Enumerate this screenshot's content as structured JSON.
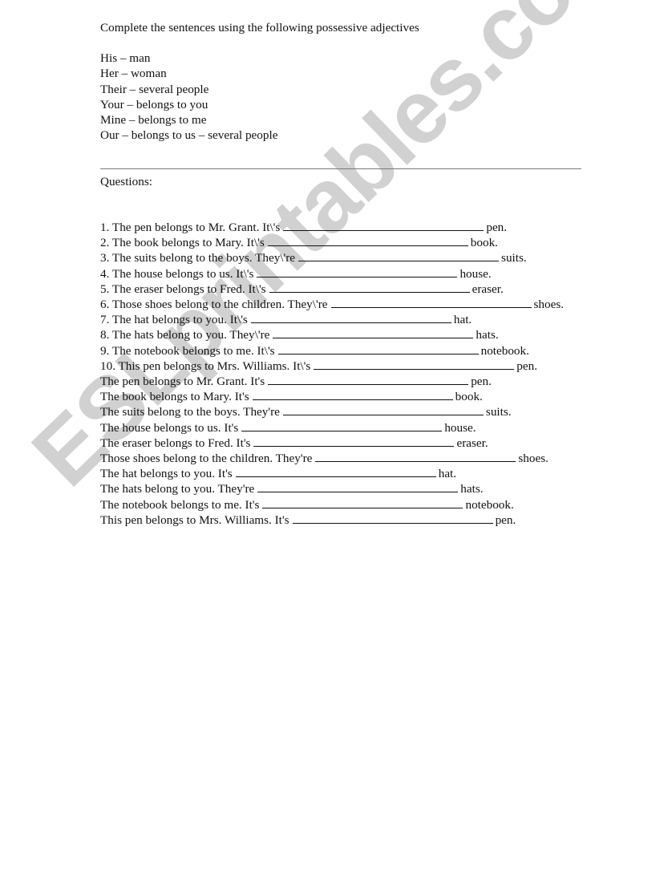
{
  "worksheet": {
    "title": "Complete the sentences using the following possessive adjectives",
    "legend": [
      "His – man",
      "Her – woman",
      "Their – several people",
      "Your – belongs to you",
      "Mine – belongs to me",
      "Our – belongs to us – several people"
    ],
    "questions_label": "Questions:",
    "questions": [
      {
        "before": "1. The pen belongs to Mr. Grant. It\\'s",
        "after": "pen."
      },
      {
        "before": "2. The book belongs to Mary. It\\'s",
        "after": "book."
      },
      {
        "before": "3. The suits belong to the boys. They\\'re",
        "after": "suits."
      },
      {
        "before": "4. The house belongs to us. It\\'s",
        "after": "house."
      },
      {
        "before": "5. The eraser belongs to Fred. It\\'s",
        "after": "eraser."
      },
      {
        "before": "6. Those shoes belong to the children. They\\'re",
        "after": "shoes."
      },
      {
        "before": "7. The hat belongs to you. It\\'s",
        "after": "hat."
      },
      {
        "before": "8. The hats belong to you. They\\'re",
        "after": "hats."
      },
      {
        "before": "9. The notebook belongs to me. It\\'s",
        "after": "notebook."
      },
      {
        "before": "10. This pen belongs to Mrs. Williams. It\\'s",
        "after": "pen."
      },
      {
        "before": "The pen belongs to Mr. Grant. It's",
        "after": "pen."
      },
      {
        "before": "The book belongs to Mary. It's",
        "after": "book."
      },
      {
        "before": "The suits belong to the boys. They're",
        "after": "suits."
      },
      {
        "before": "The house belongs to us. It's",
        "after": "house."
      },
      {
        "before": "The eraser belongs to Fred. It's",
        "after": "eraser."
      },
      {
        "before": "Those shoes belong to the children. They're",
        "after": "shoes."
      },
      {
        "before": "The hat belongs to you. It's",
        "after": "hat."
      },
      {
        "before": "The hats belong to you. They're",
        "after": "hats."
      },
      {
        "before": "The notebook belongs to me. It's",
        "after": "notebook."
      },
      {
        "before": "This pen belongs to Mrs. Williams. It's",
        "after": "pen."
      }
    ]
  },
  "watermark": {
    "text": "ESLprintables.com",
    "color": "#c9c9c9"
  }
}
